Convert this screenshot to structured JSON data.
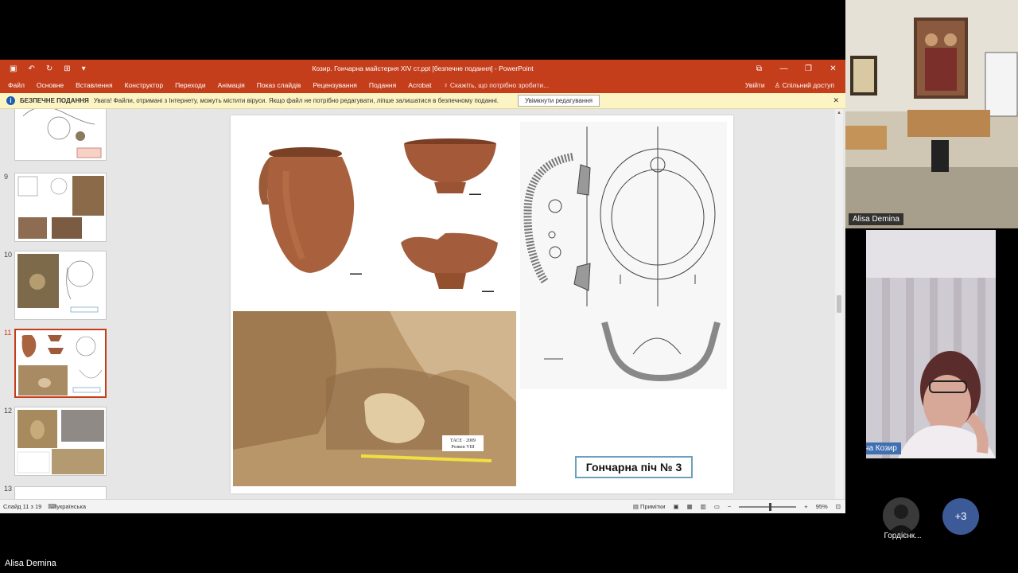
{
  "window": {
    "title": "Козир. Гончарна майстерня XIV ст.ppt [безпечне подання] - PowerPoint"
  },
  "ribbon": {
    "tabs": [
      "Файл",
      "Основне",
      "Вставлення",
      "Конструктор",
      "Переходи",
      "Анімація",
      "Показ слайдів",
      "Рецензування",
      "Подання",
      "Acrobat"
    ],
    "tell_me": "Скажіть, що потрібно зробити...",
    "sign_in": "Увійти",
    "share": "Спільний доступ"
  },
  "message_bar": {
    "header": "БЕЗПЕЧНЕ ПОДАННЯ",
    "text": "Увага! Файли, отримані з Інтернету, можуть містити віруси. Якщо файл не потрібно редагувати, ліпше залишатися в безпечному поданні.",
    "button": "Увімкнути редагування"
  },
  "thumbnails": {
    "numbers": [
      "9",
      "10",
      "11",
      "12",
      "13"
    ],
    "selected": "11"
  },
  "slide": {
    "caption": "Гончарна піч № 3",
    "sign_line1": "ТАСЕ · 2009",
    "sign_line2": "Розкоп VIII"
  },
  "status": {
    "slide_counter": "Слайд 11 з 19",
    "language": "українська",
    "notes": "Примітки",
    "zoom": "95%"
  },
  "participants": {
    "top_tile_name": "Alisa Demina",
    "speaker_name": "Ірина Козир",
    "avatar_name": "Гордієнк...",
    "more": "+3",
    "self_name": "Alisa Demina"
  },
  "colors": {
    "ppt_accent": "#c43e1c",
    "message_bar": "#fcf4c2",
    "caption_border": "#6f9fbd",
    "more_badge": "#3d5a98"
  }
}
